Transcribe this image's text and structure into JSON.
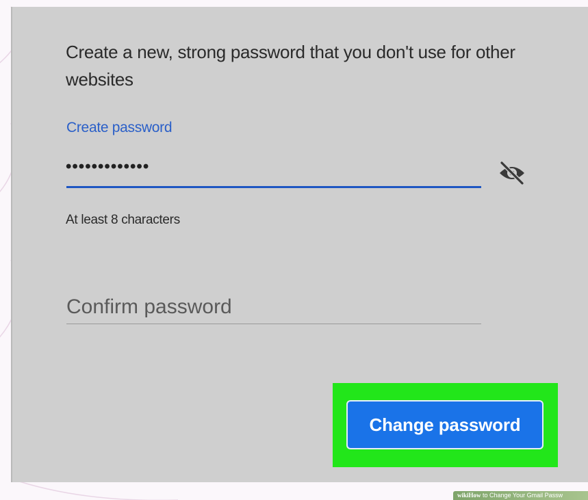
{
  "form": {
    "description": "Create a new, strong password that you don't use for other websites",
    "create_label": "Create password",
    "password_value": "•••••••••••••",
    "helper_text": "At least 8 characters",
    "confirm_placeholder": "Confirm password",
    "submit_label": "Change password"
  },
  "icons": {
    "visibility_toggle": "eye-off-icon"
  },
  "watermark": {
    "logo": "wikiHow",
    "text": "to Change Your Gmail Passw"
  },
  "colors": {
    "accent": "#1a73e8",
    "highlight": "#22e61a",
    "label": "#2a5fc8",
    "panel": "#cfcfcf"
  }
}
